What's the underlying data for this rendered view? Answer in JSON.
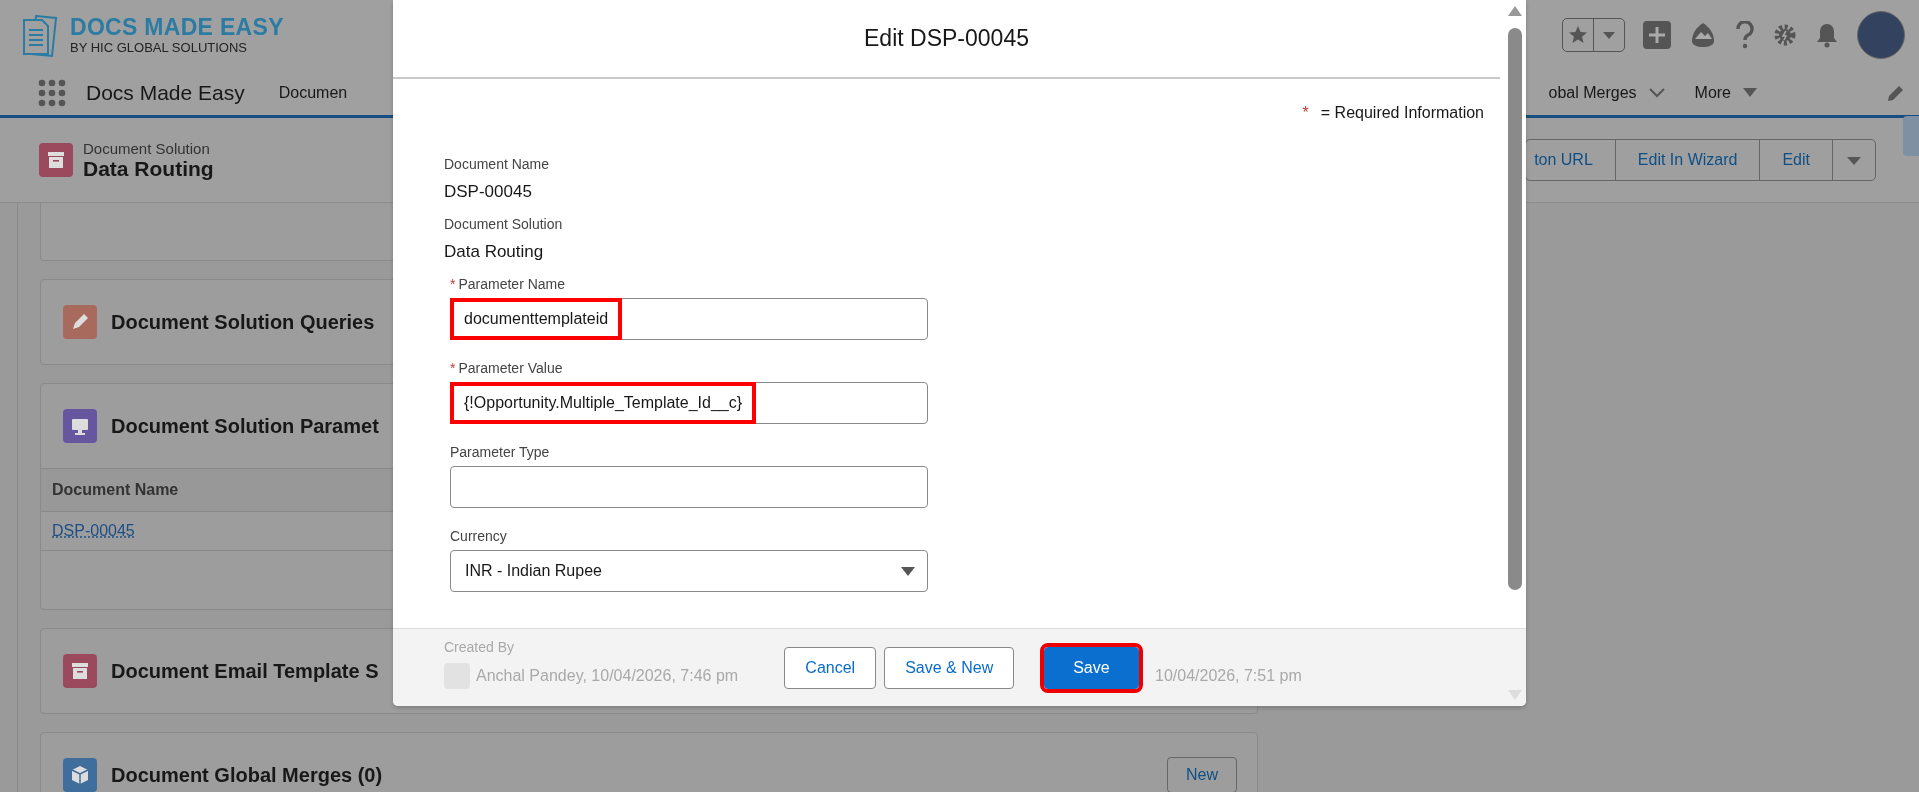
{
  "header": {
    "logo_title": "DOCS MADE EASY",
    "logo_subtitle": "BY HIC GLOBAL SOLUTIONS"
  },
  "nav": {
    "app_name": "Docs Made Easy",
    "tabs": [
      {
        "label": "Documen",
        "kind": "plain"
      },
      {
        "label": "obal Merges",
        "kind": "chevron"
      },
      {
        "label": "More",
        "kind": "caret"
      }
    ]
  },
  "record": {
    "object_type": "Document Solution",
    "name": "Data Routing",
    "actions": [
      {
        "label": "ton URL",
        "kind": "button"
      },
      {
        "label": "Edit In Wizard",
        "kind": "button"
      },
      {
        "label": "Edit",
        "kind": "button"
      },
      {
        "kind": "menu"
      }
    ]
  },
  "cards": [
    {
      "kind": "empty"
    },
    {
      "kind": "edit",
      "title": "Document Solution Queries"
    },
    {
      "kind": "params",
      "title": "Document Solution Paramet",
      "columns": [
        "Document Name"
      ],
      "rows": [
        [
          "DSP-00045"
        ]
      ]
    },
    {
      "kind": "email",
      "title": "Document Email Template S"
    },
    {
      "kind": "merges",
      "title": "Document Global Merges (0)",
      "action": "New"
    }
  ],
  "modal": {
    "title": "Edit DSP-00045",
    "required_mark": "*",
    "required_note": "= Required Information",
    "info": [
      {
        "label": "Document Name",
        "value": "DSP-00045"
      },
      {
        "label": "Document Solution",
        "value": "Data Routing"
      }
    ],
    "fields": [
      {
        "kind": "text",
        "label": "Parameter Name",
        "value": "documenttemplateid",
        "required": true,
        "highlighted": true
      },
      {
        "kind": "text",
        "label": "Parameter Value",
        "value": "{!Opportunity.Multiple_Template_Id__c}",
        "required": true,
        "highlighted": true
      },
      {
        "kind": "text",
        "label": "Parameter Type",
        "required": false,
        "highlighted": false
      },
      {
        "kind": "select",
        "label": "Currency",
        "value": "INR - Indian Rupee",
        "required": false,
        "highlighted": false
      }
    ],
    "behind_footer": {
      "created_label": "Created By",
      "created_value": "Anchal Pandey, 10/04/2026, 7:46 pm",
      "modified_value": "10/04/2026, 7:51 pm"
    },
    "buttons": [
      {
        "label": "Cancel",
        "kind": "neutral",
        "highlighted": false
      },
      {
        "label": "Save & New",
        "kind": "neutral",
        "highlighted": false
      },
      {
        "label": "Save",
        "kind": "brand",
        "highlighted": true
      }
    ]
  }
}
